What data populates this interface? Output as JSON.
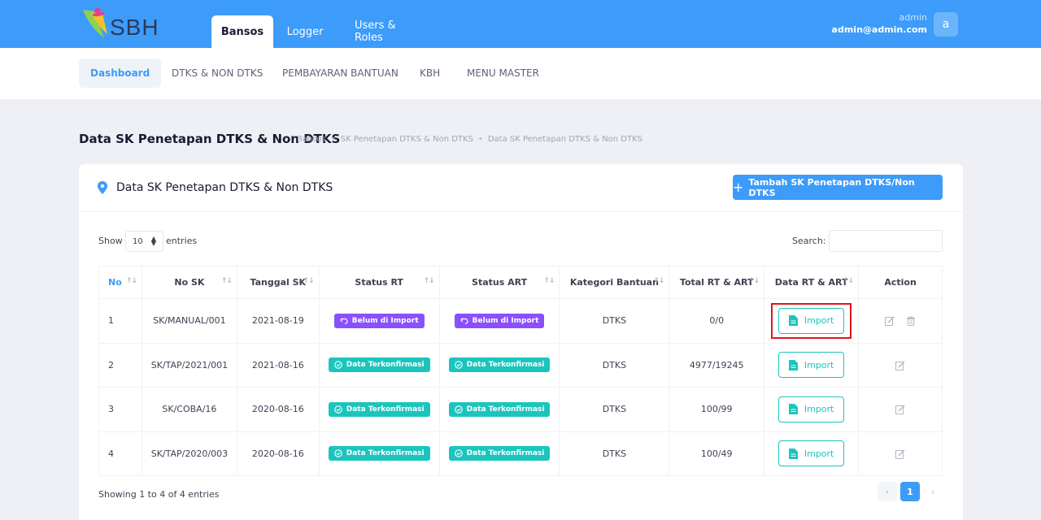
{
  "brand": {
    "logo_text": "SBH",
    "colors": {
      "primary": "#3d9bfa",
      "teal": "#1bc5bd",
      "purple": "#8950fc",
      "highlight": "#e0151c"
    }
  },
  "top_tabs": [
    {
      "label": "Bansos",
      "active": true
    },
    {
      "label": "Logger",
      "active": false
    },
    {
      "label": "Users & Roles",
      "active": false
    }
  ],
  "user": {
    "name": "admin",
    "email": "admin@admin.com",
    "avatar_letter": "a"
  },
  "subnav": [
    {
      "label": "Dashboard",
      "active": true
    },
    {
      "label": "DTKS & NON DTKS"
    },
    {
      "label": "PEMBAYARAN BANTUAN"
    },
    {
      "label": "KBH"
    },
    {
      "label": "MENU MASTER"
    }
  ],
  "page": {
    "title": "Data SK Penetapan DTKS & Non DTKS",
    "breadcrumb": [
      "Bansos",
      "SK Penetapan DTKS & Non DTKS",
      "Data SK Penetapan DTKS & Non DTKS"
    ]
  },
  "card": {
    "icon": "map-pin-icon",
    "title": "Data SK Penetapan DTKS & Non DTKS",
    "add_button": "Tambah SK Penetapan DTKS/Non DTKS"
  },
  "table_controls": {
    "show_label": "Show",
    "entries_value": "10",
    "entries_label": "entries",
    "search_label": "Search:",
    "search_value": ""
  },
  "table": {
    "headers": [
      "No",
      "No SK",
      "Tanggal SK",
      "Status RT",
      "Status ART",
      "Kategori Bantuan",
      "Total RT & ART",
      "Data RT & ART",
      "Action"
    ],
    "rows": [
      {
        "no": "1",
        "no_sk": "SK/MANUAL/001",
        "tanggal": "2021-08-19",
        "status_rt": "Belum di Import",
        "status_art": "Belum di Import",
        "kategori": "DTKS",
        "total": "0/0",
        "import": "Import",
        "deletable": true
      },
      {
        "no": "2",
        "no_sk": "SK/TAP/2021/001",
        "tanggal": "2021-08-16",
        "status_rt": "Data Terkonfirmasi",
        "status_art": "Data Terkonfirmasi",
        "kategori": "DTKS",
        "total": "4977/19245",
        "import": "Import",
        "deletable": false
      },
      {
        "no": "3",
        "no_sk": "SK/COBA/16",
        "tanggal": "2020-08-16",
        "status_rt": "Data Terkonfirmasi",
        "status_art": "Data Terkonfirmasi",
        "kategori": "DTKS",
        "total": "100/99",
        "import": "Import",
        "deletable": false
      },
      {
        "no": "4",
        "no_sk": "SK/TAP/2020/003",
        "tanggal": "2020-08-16",
        "status_rt": "Data Terkonfirmasi",
        "status_art": "Data Terkonfirmasi",
        "kategori": "DTKS",
        "total": "100/49",
        "import": "Import",
        "deletable": false
      }
    ]
  },
  "footer": {
    "showing": "Showing 1 to 4 of 4 entries",
    "current_page": "1"
  }
}
